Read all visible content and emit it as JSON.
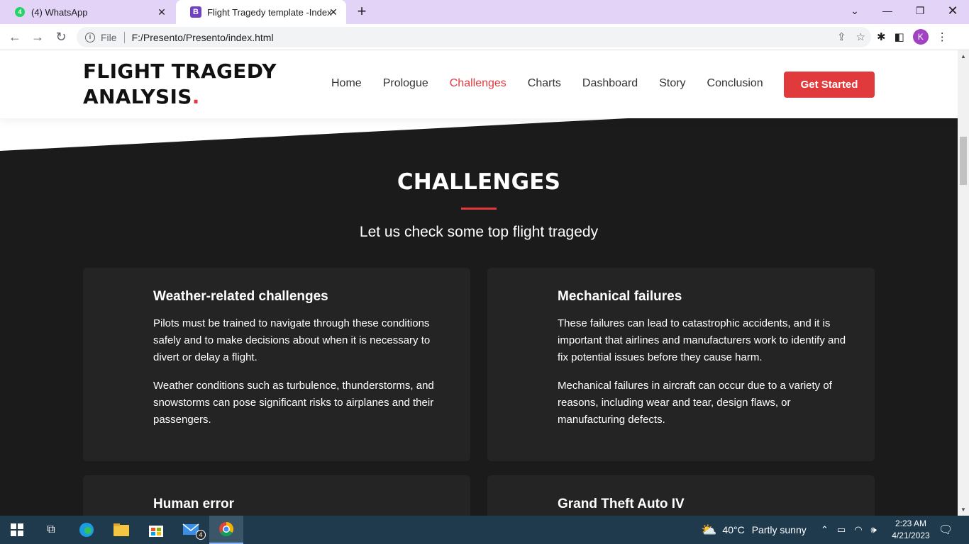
{
  "browser": {
    "tabs": [
      {
        "title": "(4) WhatsApp",
        "favicon": "whatsapp-icon",
        "favicon_text": "4"
      },
      {
        "title": "Flight Tragedy template -Index",
        "favicon": "bootstrap-icon",
        "favicon_text": "B"
      }
    ],
    "address": {
      "scheme_label": "File",
      "url": "F:/Presento/Presento/index.html"
    },
    "profile_initial": "K"
  },
  "site": {
    "logo_line1": "FLIGHT TRAGEDY",
    "logo_line2": "ANALYSIS",
    "logo_dot": ".",
    "nav": [
      "Home",
      "Prologue",
      "Challenges",
      "Charts",
      "Dashboard",
      "Story",
      "Conclusion"
    ],
    "active_nav": "Challenges",
    "cta_label": "Get Started",
    "accent_color": "#e03a3c"
  },
  "section": {
    "title": "CHALLENGES",
    "subtitle": "Let us check some top flight tragedy",
    "cards": [
      {
        "title": "Weather-related challenges",
        "paragraphs": [
          "Pilots must be trained to navigate through these conditions safely and to make decisions about when it is necessary to divert or delay a flight.",
          "Weather conditions such as turbulence, thunderstorms, and snowstorms can pose significant risks to airplanes and their passengers."
        ]
      },
      {
        "title": "Mechanical failures",
        "paragraphs": [
          "These failures can lead to catastrophic accidents, and it is important that airlines and manufacturers work to identify and fix potential issues before they cause harm.",
          "Mechanical failures in aircraft can occur due to a variety of reasons, including wear and tear, design flaws, or manufacturing defects."
        ]
      },
      {
        "title": "Human error",
        "paragraphs": []
      },
      {
        "title": "Grand Theft Auto IV",
        "paragraphs": []
      }
    ]
  },
  "taskbar": {
    "mail_badge": "4",
    "weather": {
      "temp": "40°C",
      "condition": "Partly sunny"
    },
    "time": "2:23 AM",
    "date": "4/21/2023"
  }
}
